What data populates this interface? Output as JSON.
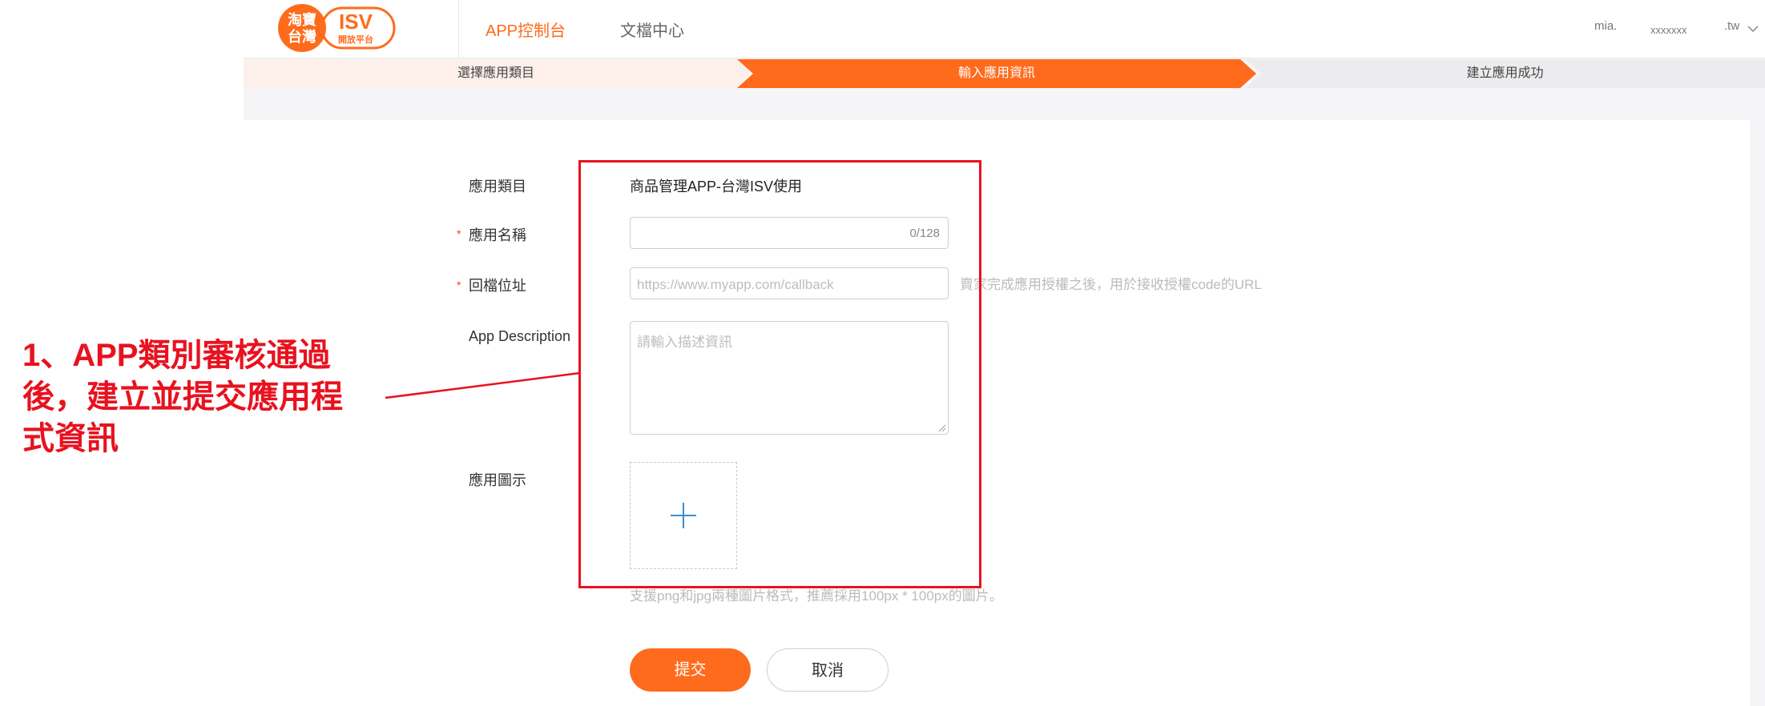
{
  "header": {
    "logo": {
      "line1": "淘寶",
      "line2": "台灣",
      "brand": "ISV",
      "sub": "開放平台"
    },
    "nav": [
      "APP控制台",
      "文檔中心"
    ],
    "user": [
      "mia.",
      "xxxxxxx",
      ".tw"
    ]
  },
  "steps": [
    "選擇應用類目",
    "輸入應用資訊",
    "建立應用成功"
  ],
  "form": {
    "category_label": "應用類目",
    "category_value": "商品管理APP-台灣ISV使用",
    "name_label": "應用名稱",
    "name_counter": "0/128",
    "callback_label": "回檔位址",
    "callback_placeholder": "https://www.myapp.com/callback",
    "callback_hint": "賣家完成應用授權之後，用於接收授權code的URL",
    "desc_label": "App Description",
    "desc_placeholder": "請輸入描述資訊",
    "icon_label": "應用圖示",
    "icon_hint": "支援png和jpg兩種圖片格式，推薦採用100px * 100px的圖片。",
    "required_mark": "*",
    "submit": "提交",
    "cancel": "取消"
  },
  "annotation": {
    "line1": "1、APP類別審核通過",
    "line2": "後，建立並提交應用程",
    "line3": "式資訊"
  },
  "colors": {
    "accent": "#ff6b1c",
    "annotation": "#e8121f",
    "plus": "#3a8fd0"
  }
}
